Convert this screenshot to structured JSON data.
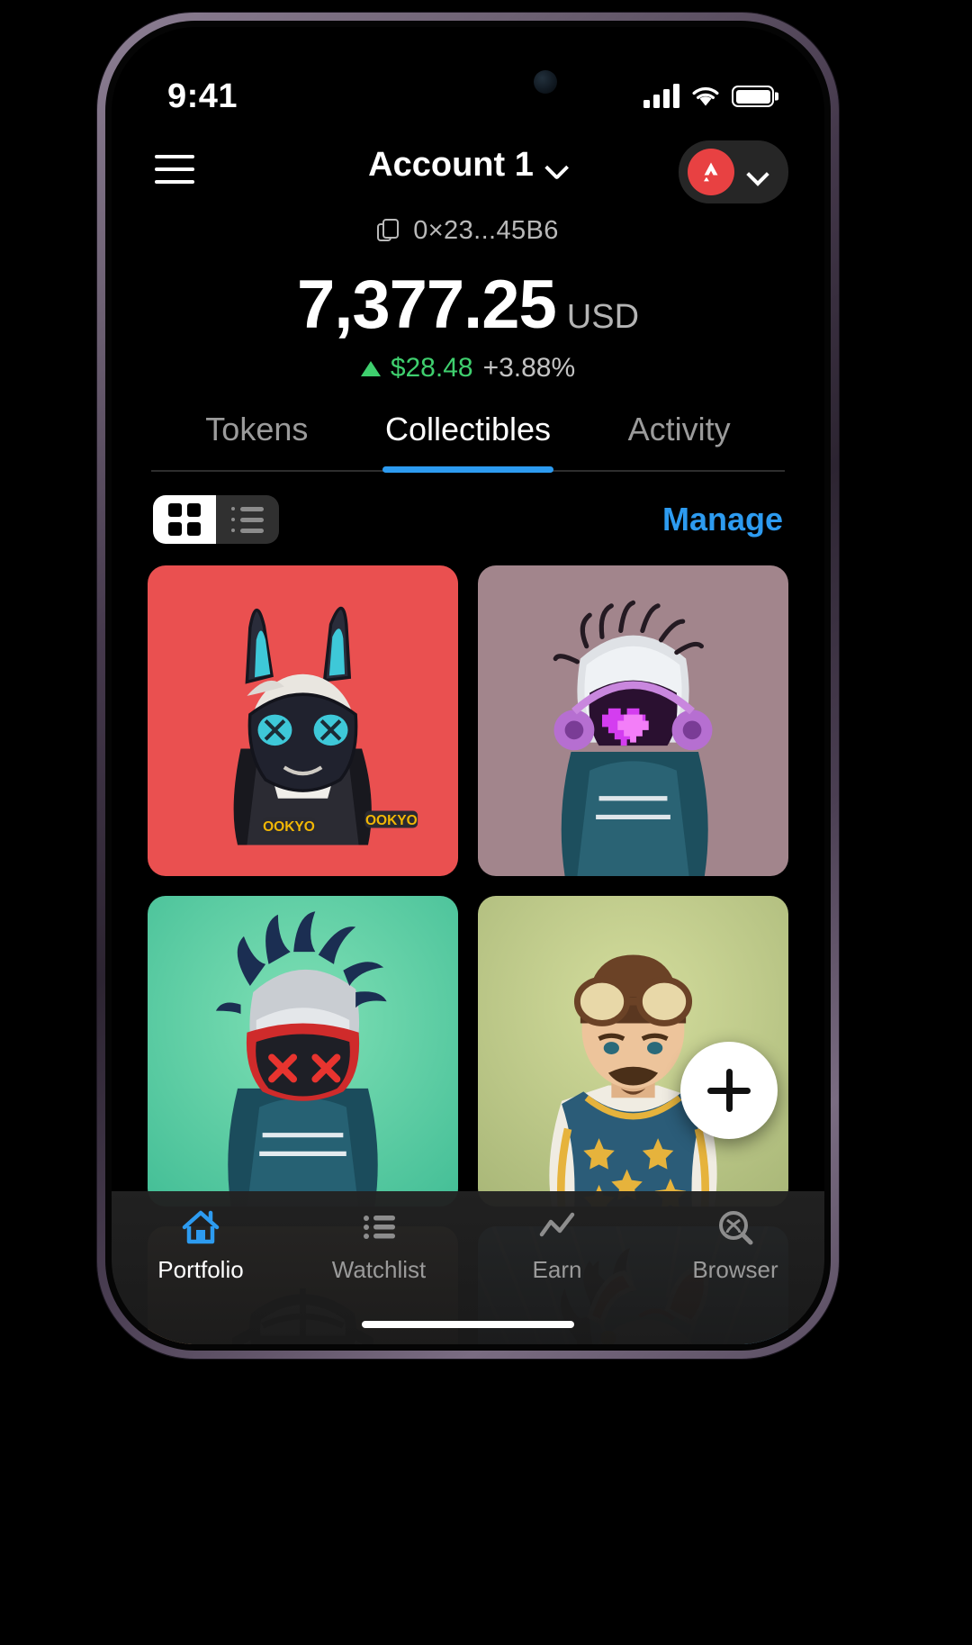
{
  "status_bar": {
    "time": "9:41",
    "signal_icon": "cellular-bars-icon",
    "wifi_icon": "wifi-icon",
    "battery_icon": "battery-full-icon"
  },
  "header": {
    "menu_icon": "hamburger-menu-icon",
    "account_name": "Account 1",
    "account_chevron_icon": "chevron-down-icon",
    "network": {
      "name": "Avalanche",
      "logo_icon": "avalanche-logo-icon",
      "logo_color": "#e84142",
      "chevron_icon": "chevron-down-icon"
    }
  },
  "account": {
    "copy_icon": "copy-icon",
    "address": "0×23...45B6",
    "balance": "7,377.25",
    "currency": "USD",
    "change_direction_icon": "triangle-up-icon",
    "change_value": "$28.48",
    "change_percent": "+3.88%",
    "positive_color": "#3fcf6e"
  },
  "tabs": [
    {
      "label": "Tokens",
      "active": false
    },
    {
      "label": "Collectibles",
      "active": true
    },
    {
      "label": "Activity",
      "active": false
    }
  ],
  "tab_accent_color": "#2d9bf0",
  "toolbar": {
    "grid_view_icon": "grid-view-icon",
    "list_view_icon": "list-view-icon",
    "grid_view_active": true,
    "manage_label": "Manage",
    "manage_color": "#2d9bf0"
  },
  "collectibles": [
    {
      "name": "ookyo-rabbit-mask-nft",
      "bg": "#ea5050"
    },
    {
      "name": "pixel-heart-helmet-nft",
      "bg": "#a2858c"
    },
    {
      "name": "red-visor-mask-nft",
      "bg": "#5fd1a5"
    },
    {
      "name": "aviator-goggles-nft",
      "bg": "#c3cf90"
    },
    {
      "name": "sailor-bear-nft",
      "bg": "#e0ab77"
    },
    {
      "name": "kitsune-fox-mask-nft",
      "bg": "#6cb9ea"
    }
  ],
  "fab": {
    "icon": "plus-icon",
    "label": "Add collectible"
  },
  "bottom_nav": [
    {
      "label": "Portfolio",
      "icon": "home-icon",
      "active": true
    },
    {
      "label": "Watchlist",
      "icon": "list-icon",
      "active": false
    },
    {
      "label": "Earn",
      "icon": "chart-line-icon",
      "active": false
    },
    {
      "label": "Browser",
      "icon": "browser-search-icon",
      "active": false
    }
  ]
}
